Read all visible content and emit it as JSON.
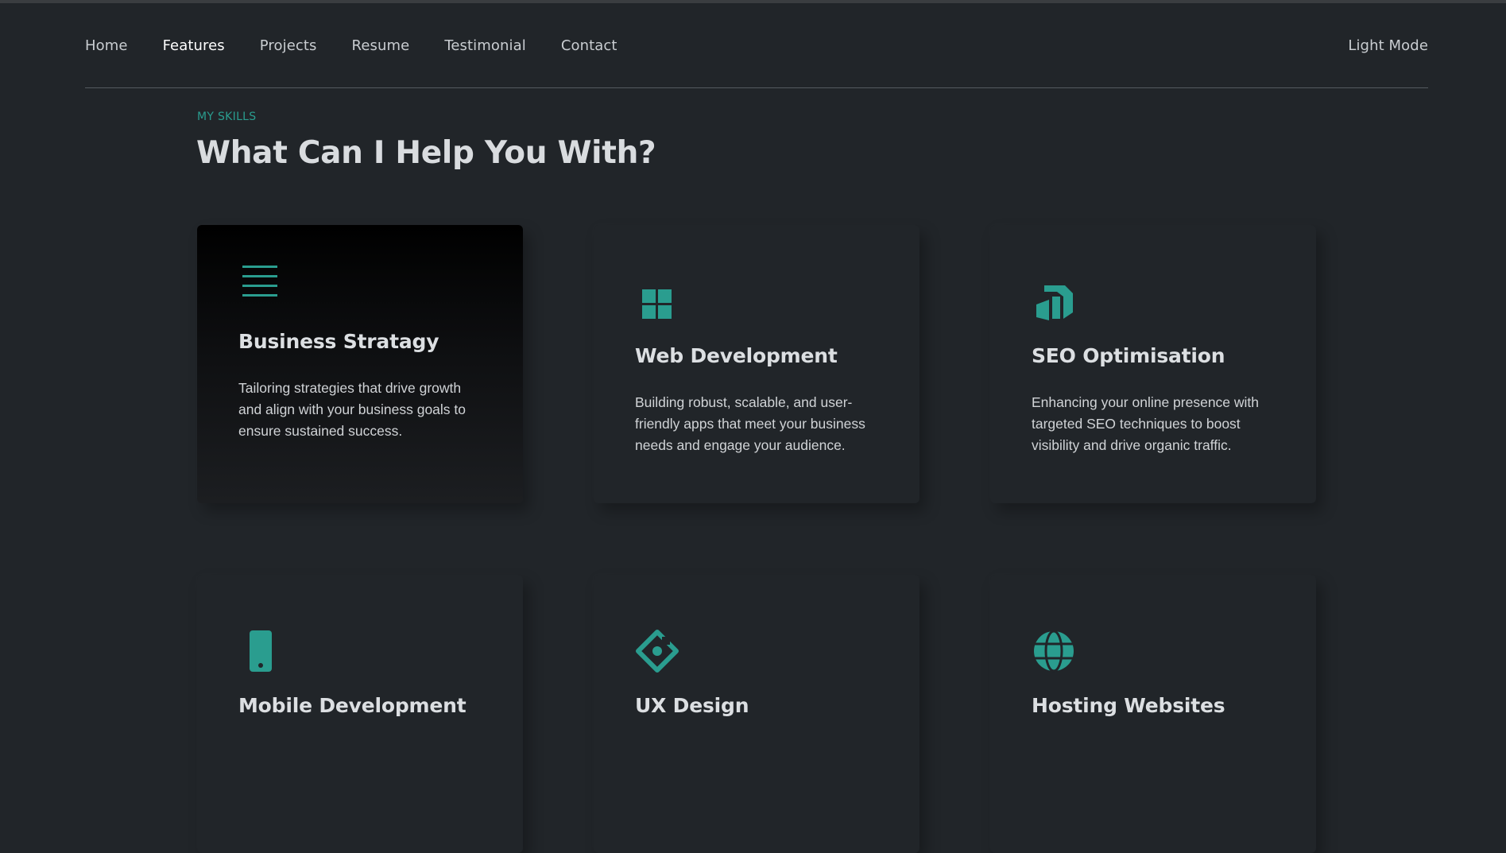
{
  "nav": {
    "links": [
      "Home",
      "Features",
      "Projects",
      "Resume",
      "Testimonial",
      "Contact"
    ],
    "active": "Features",
    "mode_toggle": "Light Mode"
  },
  "section": {
    "eyebrow": "MY SKILLS",
    "heading": "What Can I Help You With?"
  },
  "cards": [
    {
      "icon": "menu-lines-icon",
      "title": "Business Stratagy",
      "desc": "Tailoring strategies that drive growth and align with your business goals to ensure sustained success."
    },
    {
      "icon": "grid-squares-icon",
      "title": "Web Development",
      "desc": "Building robust, scalable, and user-friendly apps that meet your business needs and engage your audience."
    },
    {
      "icon": "seo-arrow-icon",
      "title": "SEO Optimisation",
      "desc": "Enhancing your online presence with targeted SEO techniques to boost visibility and drive organic traffic."
    },
    {
      "icon": "mobile-phone-icon",
      "title": "Mobile Development",
      "desc": ""
    },
    {
      "icon": "ux-diamond-icon",
      "title": "UX Design",
      "desc": ""
    },
    {
      "icon": "globe-icon",
      "title": "Hosting Websites",
      "desc": ""
    }
  ],
  "colors": {
    "background": "#212529",
    "accent": "#2a9d8f",
    "text": "#d6d9dc"
  }
}
